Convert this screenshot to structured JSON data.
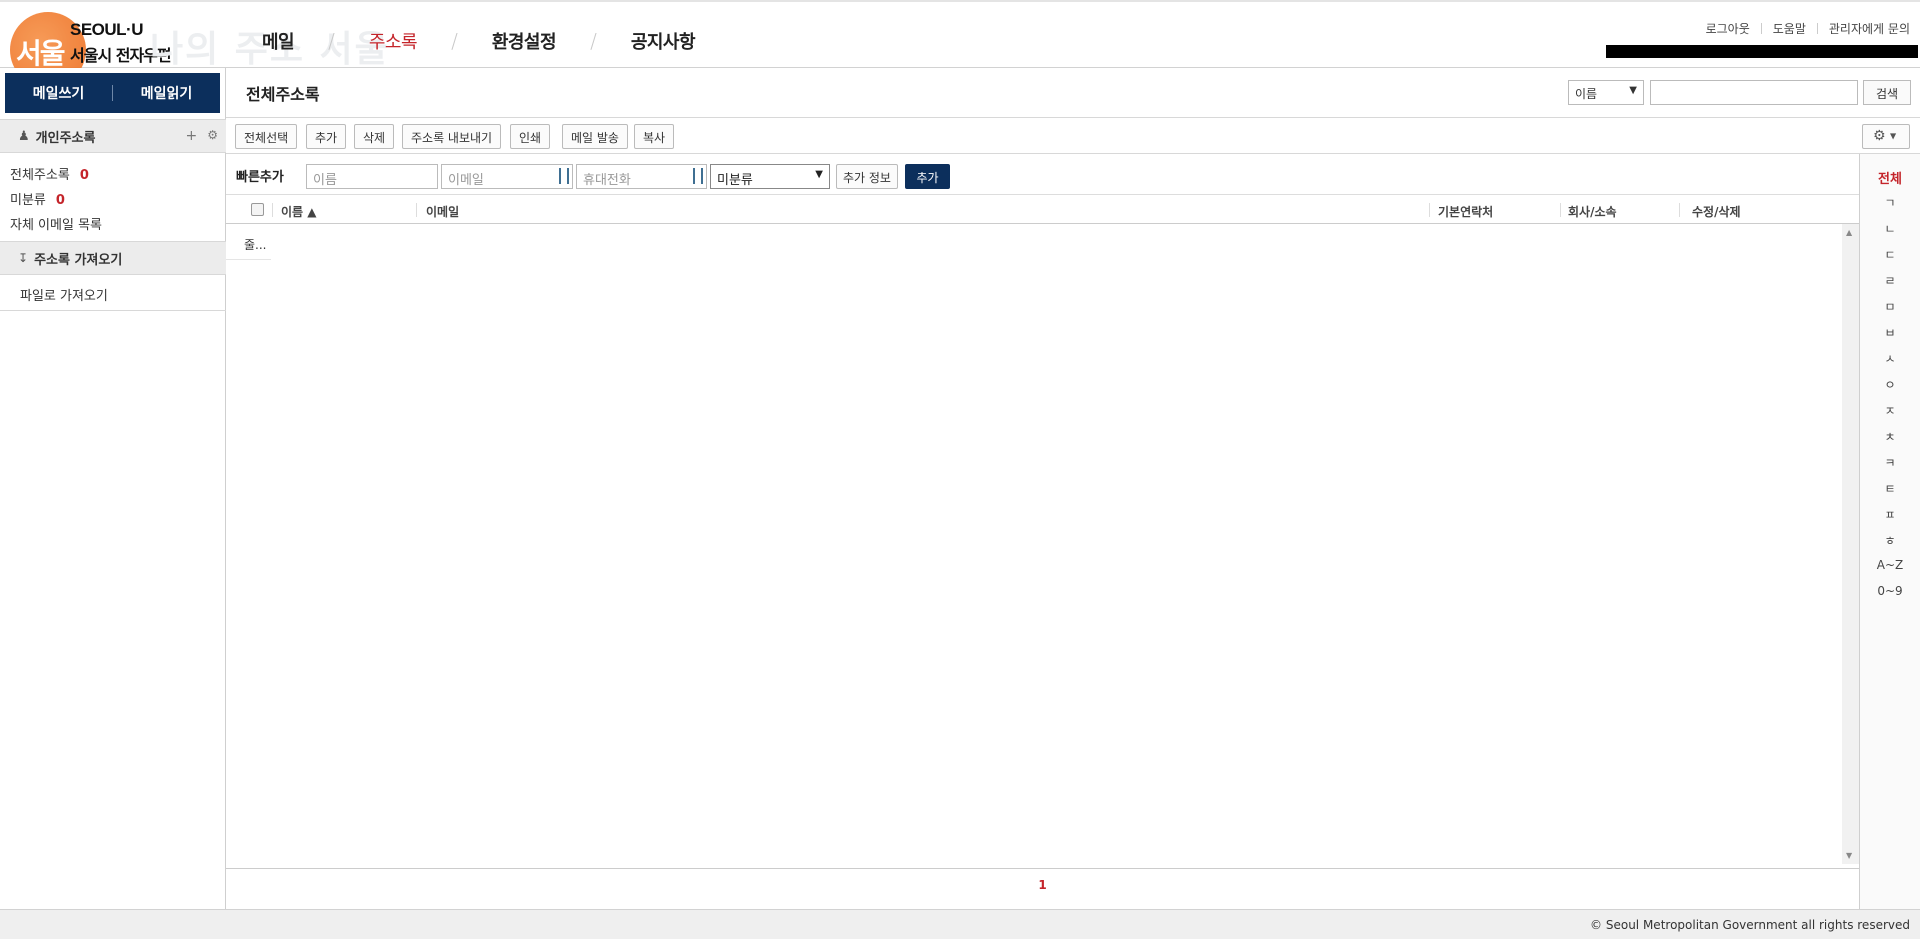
{
  "header": {
    "logo_seoul": "SEOUL·U",
    "logo_sub": "서울시 전자우편",
    "logo_mark": "서울",
    "watermark": "나의 주소 서울",
    "nav": [
      {
        "label": "메일",
        "active": false
      },
      {
        "label": "주소록",
        "active": true
      },
      {
        "label": "환경설정",
        "active": false
      },
      {
        "label": "공지사항",
        "active": false
      }
    ],
    "nav_sep": "/",
    "util": [
      "로그아웃",
      "도움말",
      "관리자에게 문의"
    ]
  },
  "sidebar": {
    "write_mail": "메일쓰기",
    "read_mail": "메일읽기",
    "personal_section": "개인주소록",
    "items": [
      {
        "label": "전체주소록",
        "count": "0"
      },
      {
        "label": "미분류",
        "count": "0"
      },
      {
        "label": "자체 이메일 목록",
        "count": ""
      }
    ],
    "import_section": "주소록 가져오기",
    "import_file": "파일로 가져오기"
  },
  "main": {
    "title": "전체주소록",
    "search": {
      "field": "이름",
      "value": "",
      "button": "검색"
    },
    "toolbar": [
      "전체선택",
      "추가",
      "삭제",
      "주소록 내보내기",
      "인쇄",
      "메일 발송",
      "복사"
    ],
    "quick_add": {
      "label": "빠른추가",
      "name_placeholder": "이름",
      "email_placeholder": "이메일",
      "phone_placeholder": "휴대전화",
      "group": "미분류",
      "more": "추가 정보",
      "add": "추가"
    },
    "columns": {
      "name": "이름 ▲",
      "email": "이메일",
      "contact": "기본연락처",
      "company": "회사/소속",
      "edit": "수정/삭제"
    },
    "loading_text": "줄...",
    "page": "1"
  },
  "alpha_index": [
    "전체",
    "ㄱ",
    "ㄴ",
    "ㄷ",
    "ㄹ",
    "ㅁ",
    "ㅂ",
    "ㅅ",
    "ㅇ",
    "ㅈ",
    "ㅊ",
    "ㅋ",
    "ㅌ",
    "ㅍ",
    "ㅎ",
    "A~Z",
    "0~9"
  ],
  "footer": "© Seoul Metropolitan Government all rights reserved",
  "colors": {
    "accent": "#c4242a",
    "navy": "#0c2f5c",
    "logo_orange": "#ec6e22"
  }
}
